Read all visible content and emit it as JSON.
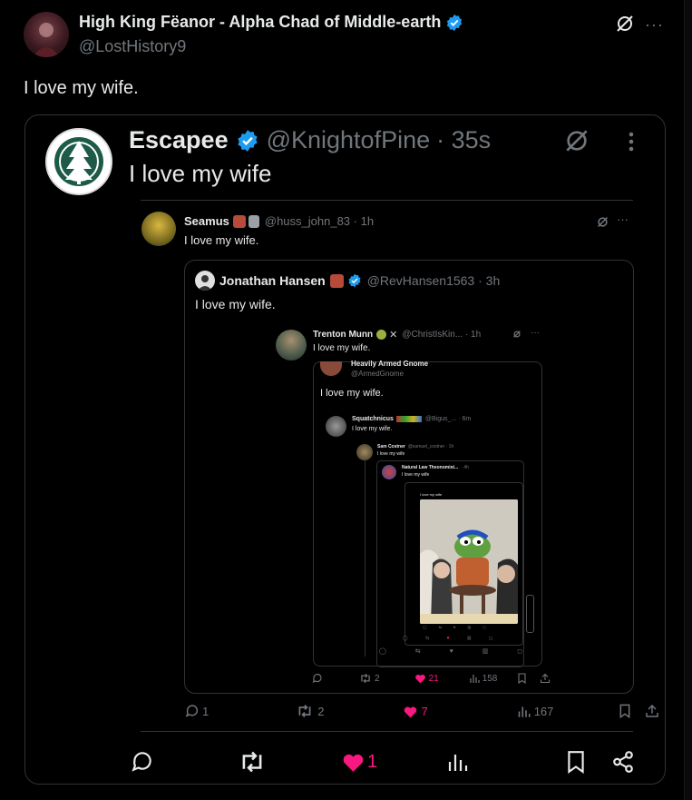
{
  "tweet": {
    "author_name": "High King Fëanor - Alpha Chad of Middle-earth",
    "author_handle": "@LostHistory9",
    "text": "I love my wife.",
    "likes": "1"
  },
  "quote1": {
    "author_name": "Escapee",
    "author_handle": "@KnightofPine",
    "time": "· 35s",
    "text": "I love my wife"
  },
  "quote2": {
    "author_name": "Seamus",
    "author_handle": "@huss_john_83 · 1h",
    "text": "I love my wife.",
    "replies": "1",
    "reposts": "2",
    "likes": "7",
    "views": "167"
  },
  "quote3": {
    "author_name": "Jonathan Hansen",
    "author_handle": "@RevHansen1563 · 3h",
    "text": "I love my wife.",
    "reposts": "2",
    "likes": "21",
    "views": "158"
  },
  "quote4": {
    "author_name": "Trenton Munn",
    "author_handle": "@ChristIsKin... · 1h",
    "text": "I love my wife."
  },
  "quote5": {
    "author_name": "Heavily Armed Gnome",
    "author_handle": "@ArmedGnome",
    "text": "I love my wife."
  },
  "quote6": {
    "author_name": "Squatchnicus",
    "author_handle": "@Bigus_... · 6m",
    "text": "I love my wife."
  },
  "quote7": {
    "author_name": "Sam Costner",
    "author_handle": "@samuel_costner · 1h",
    "text": "I love my wife"
  },
  "quote8": {
    "author_name": "Natural Law Theonomist...",
    "author_handle": "· 4h",
    "text": "I love my wife"
  },
  "quote9": {
    "text": "I love my wife"
  },
  "colors": {
    "background": "#000000",
    "verified": "#1d9bf0",
    "like_pink": "#f91880",
    "muted": "#71767b"
  }
}
